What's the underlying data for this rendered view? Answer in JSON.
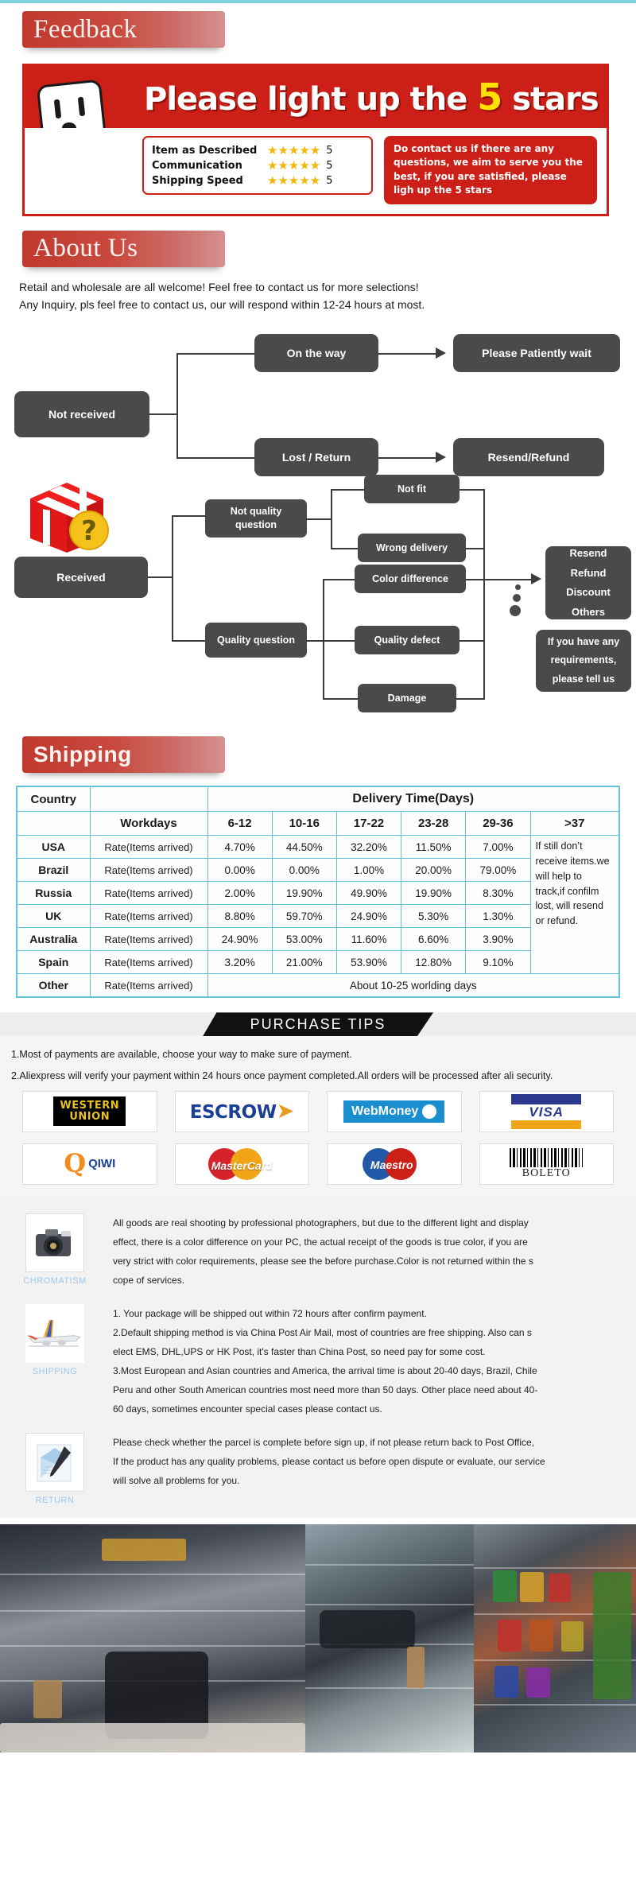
{
  "feedback": {
    "header": "Feedback",
    "banner": {
      "headline_pre": "Please light up the",
      "headline_num": "5",
      "headline_post": "stars",
      "ratings": [
        {
          "label": "Item as Described",
          "stars": "★★★★★",
          "value": "5"
        },
        {
          "label": "Communication",
          "stars": "★★★★★",
          "value": "5"
        },
        {
          "label": "Shipping Speed",
          "stars": "★★★★★",
          "value": "5"
        }
      ],
      "contact_text": "Do contact us if there are any questions, we aim to serve you the best, if you are satisfied, please ligh up the 5 stars"
    }
  },
  "about": {
    "header": "About Us",
    "line1": "Retail and wholesale are all welcome! Feel free to contact us for more selections!",
    "line2": "Any Inquiry, pls feel free to contact us, our will respond within 12-24 hours at most."
  },
  "flowchart": {
    "not_received": "Not received",
    "on_the_way": "On the way",
    "patiently_wait": "Please Patiently wait",
    "lost_return": "Lost / Return",
    "resend_refund": "Resend/Refund",
    "received": "Received",
    "not_quality_question": "Not quality question",
    "quality_question": "Quality question",
    "not_fit": "Not fit",
    "wrong_delivery": "Wrong delivery",
    "color_difference": "Color difference",
    "quality_defect": "Quality defect",
    "damage": "Damage",
    "outcomes": "Resend\nRefund\nDiscount\nOthers",
    "requirements": "If you have any requirements, please tell us"
  },
  "shipping": {
    "header": "Shipping",
    "table": {
      "country_header": "Country",
      "delivery_header": "Delivery Time(Days)",
      "workdays_header": "Workdays",
      "day_ranges": [
        "6-12",
        "10-16",
        "17-22",
        "23-28",
        "29-36",
        ">37"
      ],
      "rate_label": "Rate(Items arrived)",
      "rows": [
        {
          "country": "USA",
          "rate": "Rate(Items arrived)",
          "values": [
            "4.70%",
            "44.50%",
            "32.20%",
            "11.50%",
            "7.00%"
          ]
        },
        {
          "country": "Brazil",
          "rate": "Rate(Items arrived)",
          "values": [
            "0.00%",
            "0.00%",
            "1.00%",
            "20.00%",
            "79.00%"
          ]
        },
        {
          "country": "Russia",
          "rate": "Rate(Items arrived)",
          "values": [
            "2.00%",
            "19.90%",
            "49.90%",
            "19.90%",
            "8.30%"
          ]
        },
        {
          "country": "UK",
          "rate": "Rate(Items arrived)",
          "values": [
            "8.80%",
            "59.70%",
            "24.90%",
            "5.30%",
            "1.30%"
          ]
        },
        {
          "country": "Australia",
          "rate": "Rate(Items arrived)",
          "values": [
            "24.90%",
            "53.00%",
            "11.60%",
            "6.60%",
            "3.90%"
          ]
        },
        {
          "country": "Spain",
          "rate": "Rate(Items arrived)",
          "values": [
            "3.20%",
            "21.00%",
            "53.90%",
            "12.80%",
            "9.10%"
          ]
        }
      ],
      "other_row": {
        "country": "Other",
        "rate": "Rate(Items arrived)",
        "text": "About 10-25 worlding days"
      },
      "side_note": "If still don’t receive items.we will help to track,if confilm lost, will resend or refund."
    }
  },
  "purchase_tips": {
    "ribbon": "PURCHASE TIPS",
    "tip1": "1.Most of payments are available, choose your way to make sure of payment.",
    "tip2": "2.Aliexpress will verify your payment within 24 hours once payment completed.All orders will be processed after ali security.",
    "payments": [
      {
        "name": "western-union",
        "line1": "WESTERN",
        "line2": "UNION"
      },
      {
        "name": "escrow",
        "text": "ESCROW"
      },
      {
        "name": "webmoney",
        "text": "WebMoney"
      },
      {
        "name": "visa",
        "text": "VISA"
      },
      {
        "name": "qiwi",
        "text": "QIWI"
      },
      {
        "name": "mastercard",
        "text": "MasterCard"
      },
      {
        "name": "maestro",
        "text": "Maestro"
      },
      {
        "name": "boleto",
        "text": "BOLETO"
      }
    ],
    "info": [
      {
        "icon": "camera-icon",
        "label": "CHROMATISM",
        "lines": [
          "All goods are real shooting by professional photographers, but due to the different light and display",
          "effect, there is a color difference on your PC, the actual receipt of the goods is true color, if you are",
          "very strict with color requirements, please see the before purchase.Color is not returned within the s",
          "cope of services."
        ]
      },
      {
        "icon": "airplane-icon",
        "label": "SHIPPING",
        "lines": [
          "1. Your package will be shipped out within 72 hours after confirm payment.",
          "2.Default shipping method is via China Post Air Mail, most of countries are free shipping. Also can s",
          "elect EMS, DHL,UPS or HK Post, it's faster than China Post, so need pay for some cost.",
          "3.Most European and Asian countries and America, the arrival time is about 20-40 days, Brazil, Chile",
          "Peru and other South American countries most need more than 50 days. Other place need about 40-",
          "60 days, sometimes encounter special cases please contact us."
        ]
      },
      {
        "icon": "envelope-pen-icon",
        "label": "RETURN",
        "lines": [
          "Please check whether the parcel is complete before sign up, if not please return back to Post Office,",
          "If the product has any quality problems, please contact us before open dispute or evaluate, our service",
          "will solve all problems for you."
        ]
      }
    ]
  },
  "photos": [
    {
      "name": "store-interior-motorcycle"
    },
    {
      "name": "store-shelves-parts"
    },
    {
      "name": "store-shelves-colored-parts"
    }
  ],
  "colors": {
    "header_red": "#c0392e",
    "banner_red": "#cc1f18",
    "table_border": "#63c3d8",
    "node_gray": "#4a4a4a",
    "star_gold": "#f5b60a",
    "info_label_blue": "#9fc7e8"
  }
}
